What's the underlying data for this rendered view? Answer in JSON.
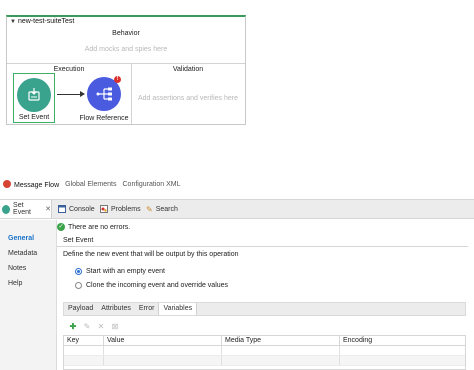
{
  "suite": {
    "name": "new-test-suiteTest",
    "behavior_title": "Behavior",
    "behavior_hint": "Add mocks and spies here",
    "execution_title": "Execution",
    "validation_title": "Validation",
    "validation_hint": "Add assertions and verifies here",
    "steps": [
      {
        "label": "Set Event",
        "icon": "set-event-icon"
      },
      {
        "label": "Flow Reference",
        "icon": "flow-reference-icon",
        "badge": "!"
      }
    ]
  },
  "editor_tabs": [
    "Message Flow",
    "Global Elements",
    "Configuration XML"
  ],
  "panel_tabs": {
    "active": "Set Event",
    "others": [
      "Console",
      "Problems",
      "Search"
    ]
  },
  "sidebar": [
    "General",
    "Metadata",
    "Notes",
    "Help"
  ],
  "content": {
    "status": "There are no errors.",
    "section_title": "Set Event",
    "description": "Define the new event that will be output by this operation",
    "options": [
      {
        "label": "Start with an empty event",
        "selected": true
      },
      {
        "label": "Clone the incoming event and override values",
        "selected": false
      }
    ],
    "inner_tabs": [
      "Payload",
      "Attributes",
      "Error",
      "Variables"
    ],
    "active_inner_tab": "Variables",
    "columns": [
      "Key",
      "Value",
      "Media Type",
      "Encoding"
    ]
  },
  "colors": {
    "accent_green": "#3fae66",
    "teal": "#3aa38d",
    "flow_blue": "#4a5be0",
    "error_red": "#d9302c"
  }
}
